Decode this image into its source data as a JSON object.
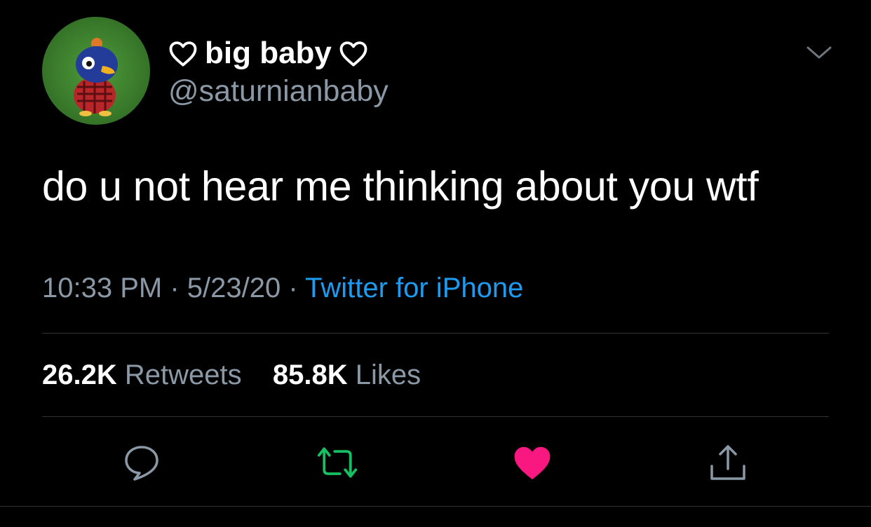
{
  "author": {
    "display_name": "big baby",
    "handle": "@saturnianbaby",
    "name_decoration_icon": "heart-outline-icon"
  },
  "tweet": {
    "text": "do u not hear me thinking about you wtf",
    "time": "10:33 PM",
    "date": "5/23/20",
    "separator": "·",
    "source": "Twitter for iPhone"
  },
  "stats": {
    "retweets_count": "26.2K",
    "retweets_label": "Retweets",
    "likes_count": "85.8K",
    "likes_label": "Likes"
  },
  "actions": {
    "reply_icon": "speech-bubble-icon",
    "retweet_icon": "retweet-arrows-icon",
    "like_icon": "heart-filled-icon",
    "share_icon": "share-upload-icon",
    "liked": true
  },
  "colors": {
    "background": "#000000",
    "text": "#ffffff",
    "secondary_text": "#8b98a5",
    "link": "#1d9bf0",
    "retweet_green": "#17bf63",
    "like_pink": "#f91880",
    "divider": "#2f3336"
  }
}
